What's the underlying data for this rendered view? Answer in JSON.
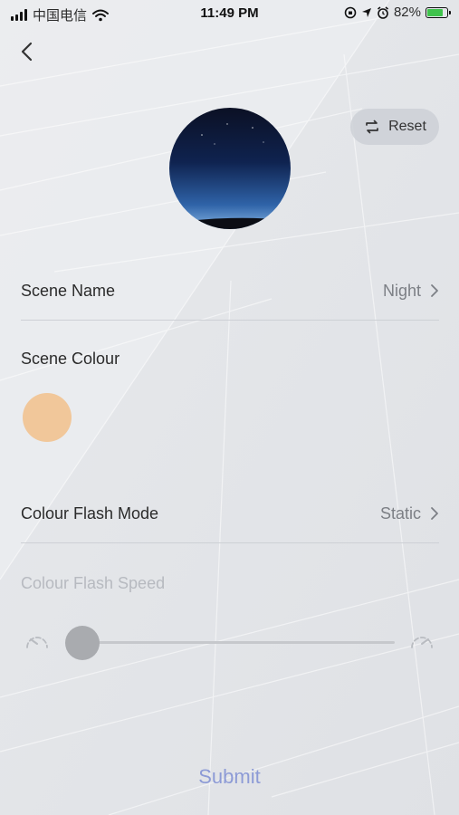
{
  "status_bar": {
    "carrier": "中国电信",
    "time": "11:49 PM",
    "battery_percent": "82%",
    "battery_level": 0.82,
    "battery_color": "#3fc34c"
  },
  "reset_button": {
    "label": "Reset"
  },
  "scene_name": {
    "label": "Scene Name",
    "value": "Night"
  },
  "scene_colour": {
    "label": "Scene Colour",
    "color": "#f1c79a"
  },
  "flash_mode": {
    "label": "Colour Flash Mode",
    "value": "Static"
  },
  "flash_speed": {
    "label": "Colour Flash Speed",
    "level": 0
  },
  "submit": {
    "label": "Submit",
    "color": "#8d9bd6"
  },
  "icons": [
    "back-chevron-icon",
    "refresh-icon",
    "chevron-right-icon",
    "slow-speed-icon",
    "fast-speed-icon",
    "wifi-icon",
    "location-arrow-icon",
    "alarm-icon",
    "lock-rotation-icon"
  ]
}
